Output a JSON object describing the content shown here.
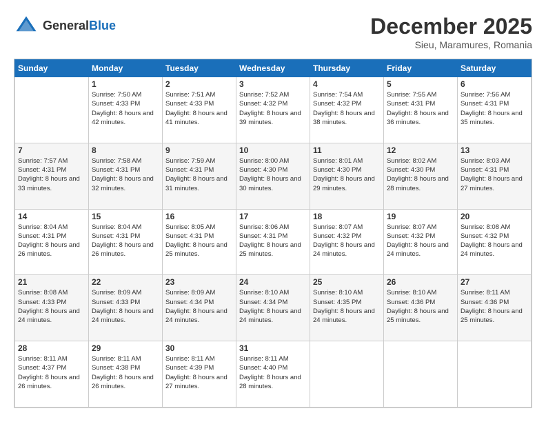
{
  "header": {
    "logo": {
      "line1": "General",
      "line2": "Blue"
    },
    "month": "December 2025",
    "location": "Sieu, Maramures, Romania"
  },
  "weekdays": [
    "Sunday",
    "Monday",
    "Tuesday",
    "Wednesday",
    "Thursday",
    "Friday",
    "Saturday"
  ],
  "weeks": [
    [
      {
        "day": "",
        "sunrise": "",
        "sunset": "",
        "daylight": ""
      },
      {
        "day": "1",
        "sunrise": "Sunrise: 7:50 AM",
        "sunset": "Sunset: 4:33 PM",
        "daylight": "Daylight: 8 hours and 42 minutes."
      },
      {
        "day": "2",
        "sunrise": "Sunrise: 7:51 AM",
        "sunset": "Sunset: 4:33 PM",
        "daylight": "Daylight: 8 hours and 41 minutes."
      },
      {
        "day": "3",
        "sunrise": "Sunrise: 7:52 AM",
        "sunset": "Sunset: 4:32 PM",
        "daylight": "Daylight: 8 hours and 39 minutes."
      },
      {
        "day": "4",
        "sunrise": "Sunrise: 7:54 AM",
        "sunset": "Sunset: 4:32 PM",
        "daylight": "Daylight: 8 hours and 38 minutes."
      },
      {
        "day": "5",
        "sunrise": "Sunrise: 7:55 AM",
        "sunset": "Sunset: 4:31 PM",
        "daylight": "Daylight: 8 hours and 36 minutes."
      },
      {
        "day": "6",
        "sunrise": "Sunrise: 7:56 AM",
        "sunset": "Sunset: 4:31 PM",
        "daylight": "Daylight: 8 hours and 35 minutes."
      }
    ],
    [
      {
        "day": "7",
        "sunrise": "Sunrise: 7:57 AM",
        "sunset": "Sunset: 4:31 PM",
        "daylight": "Daylight: 8 hours and 33 minutes."
      },
      {
        "day": "8",
        "sunrise": "Sunrise: 7:58 AM",
        "sunset": "Sunset: 4:31 PM",
        "daylight": "Daylight: 8 hours and 32 minutes."
      },
      {
        "day": "9",
        "sunrise": "Sunrise: 7:59 AM",
        "sunset": "Sunset: 4:31 PM",
        "daylight": "Daylight: 8 hours and 31 minutes."
      },
      {
        "day": "10",
        "sunrise": "Sunrise: 8:00 AM",
        "sunset": "Sunset: 4:30 PM",
        "daylight": "Daylight: 8 hours and 30 minutes."
      },
      {
        "day": "11",
        "sunrise": "Sunrise: 8:01 AM",
        "sunset": "Sunset: 4:30 PM",
        "daylight": "Daylight: 8 hours and 29 minutes."
      },
      {
        "day": "12",
        "sunrise": "Sunrise: 8:02 AM",
        "sunset": "Sunset: 4:30 PM",
        "daylight": "Daylight: 8 hours and 28 minutes."
      },
      {
        "day": "13",
        "sunrise": "Sunrise: 8:03 AM",
        "sunset": "Sunset: 4:31 PM",
        "daylight": "Daylight: 8 hours and 27 minutes."
      }
    ],
    [
      {
        "day": "14",
        "sunrise": "Sunrise: 8:04 AM",
        "sunset": "Sunset: 4:31 PM",
        "daylight": "Daylight: 8 hours and 26 minutes."
      },
      {
        "day": "15",
        "sunrise": "Sunrise: 8:04 AM",
        "sunset": "Sunset: 4:31 PM",
        "daylight": "Daylight: 8 hours and 26 minutes."
      },
      {
        "day": "16",
        "sunrise": "Sunrise: 8:05 AM",
        "sunset": "Sunset: 4:31 PM",
        "daylight": "Daylight: 8 hours and 25 minutes."
      },
      {
        "day": "17",
        "sunrise": "Sunrise: 8:06 AM",
        "sunset": "Sunset: 4:31 PM",
        "daylight": "Daylight: 8 hours and 25 minutes."
      },
      {
        "day": "18",
        "sunrise": "Sunrise: 8:07 AM",
        "sunset": "Sunset: 4:32 PM",
        "daylight": "Daylight: 8 hours and 24 minutes."
      },
      {
        "day": "19",
        "sunrise": "Sunrise: 8:07 AM",
        "sunset": "Sunset: 4:32 PM",
        "daylight": "Daylight: 8 hours and 24 minutes."
      },
      {
        "day": "20",
        "sunrise": "Sunrise: 8:08 AM",
        "sunset": "Sunset: 4:32 PM",
        "daylight": "Daylight: 8 hours and 24 minutes."
      }
    ],
    [
      {
        "day": "21",
        "sunrise": "Sunrise: 8:08 AM",
        "sunset": "Sunset: 4:33 PM",
        "daylight": "Daylight: 8 hours and 24 minutes."
      },
      {
        "day": "22",
        "sunrise": "Sunrise: 8:09 AM",
        "sunset": "Sunset: 4:33 PM",
        "daylight": "Daylight: 8 hours and 24 minutes."
      },
      {
        "day": "23",
        "sunrise": "Sunrise: 8:09 AM",
        "sunset": "Sunset: 4:34 PM",
        "daylight": "Daylight: 8 hours and 24 minutes."
      },
      {
        "day": "24",
        "sunrise": "Sunrise: 8:10 AM",
        "sunset": "Sunset: 4:34 PM",
        "daylight": "Daylight: 8 hours and 24 minutes."
      },
      {
        "day": "25",
        "sunrise": "Sunrise: 8:10 AM",
        "sunset": "Sunset: 4:35 PM",
        "daylight": "Daylight: 8 hours and 24 minutes."
      },
      {
        "day": "26",
        "sunrise": "Sunrise: 8:10 AM",
        "sunset": "Sunset: 4:36 PM",
        "daylight": "Daylight: 8 hours and 25 minutes."
      },
      {
        "day": "27",
        "sunrise": "Sunrise: 8:11 AM",
        "sunset": "Sunset: 4:36 PM",
        "daylight": "Daylight: 8 hours and 25 minutes."
      }
    ],
    [
      {
        "day": "28",
        "sunrise": "Sunrise: 8:11 AM",
        "sunset": "Sunset: 4:37 PM",
        "daylight": "Daylight: 8 hours and 26 minutes."
      },
      {
        "day": "29",
        "sunrise": "Sunrise: 8:11 AM",
        "sunset": "Sunset: 4:38 PM",
        "daylight": "Daylight: 8 hours and 26 minutes."
      },
      {
        "day": "30",
        "sunrise": "Sunrise: 8:11 AM",
        "sunset": "Sunset: 4:39 PM",
        "daylight": "Daylight: 8 hours and 27 minutes."
      },
      {
        "day": "31",
        "sunrise": "Sunrise: 8:11 AM",
        "sunset": "Sunset: 4:40 PM",
        "daylight": "Daylight: 8 hours and 28 minutes."
      },
      {
        "day": "",
        "sunrise": "",
        "sunset": "",
        "daylight": ""
      },
      {
        "day": "",
        "sunrise": "",
        "sunset": "",
        "daylight": ""
      },
      {
        "day": "",
        "sunrise": "",
        "sunset": "",
        "daylight": ""
      }
    ]
  ]
}
